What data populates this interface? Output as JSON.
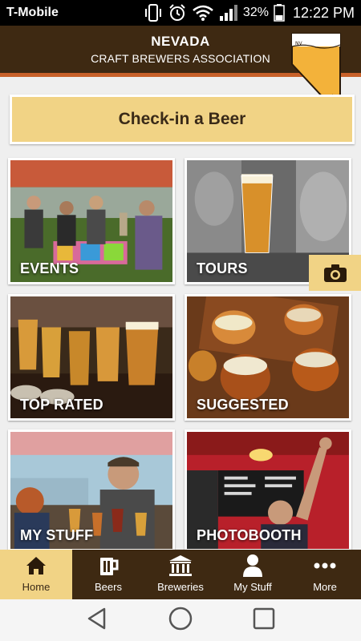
{
  "status_bar": {
    "carrier": "T-Mobile",
    "battery": "32%",
    "time": "12:22 PM",
    "icons": [
      "phone-vibrate-icon",
      "alarm-icon",
      "wifi-icon",
      "signal-icon",
      "battery-icon"
    ]
  },
  "header": {
    "title": "NEVADA",
    "subtitle": "CRAFT BREWERS ASSOCIATION",
    "logo_icon": "nevada-beer-glass-icon"
  },
  "checkin": {
    "label": "Check-in a Beer"
  },
  "tiles": [
    {
      "label": "EVENTS"
    },
    {
      "label": "TOURS"
    },
    {
      "label": "TOP RATED"
    },
    {
      "label": "SUGGESTED"
    },
    {
      "label": "MY STUFF"
    },
    {
      "label": "PHOTOBOOTH"
    }
  ],
  "camera_button": {
    "icon": "camera-icon"
  },
  "bottom_nav": [
    {
      "label": "Home",
      "icon": "home-icon",
      "active": true
    },
    {
      "label": "Beers",
      "icon": "beer-mug-icon",
      "active": false
    },
    {
      "label": "Breweries",
      "icon": "building-icon",
      "active": false
    },
    {
      "label": "My Stuff",
      "icon": "user-icon",
      "active": false
    },
    {
      "label": "More",
      "icon": "more-icon",
      "active": false
    }
  ],
  "android_nav": [
    "back-icon",
    "home-circle-icon",
    "recents-icon"
  ],
  "colors": {
    "brand_brown": "#3e2912",
    "accent_orange": "#c8612a",
    "accent_gold": "#f1d385",
    "background": "#efefef"
  }
}
